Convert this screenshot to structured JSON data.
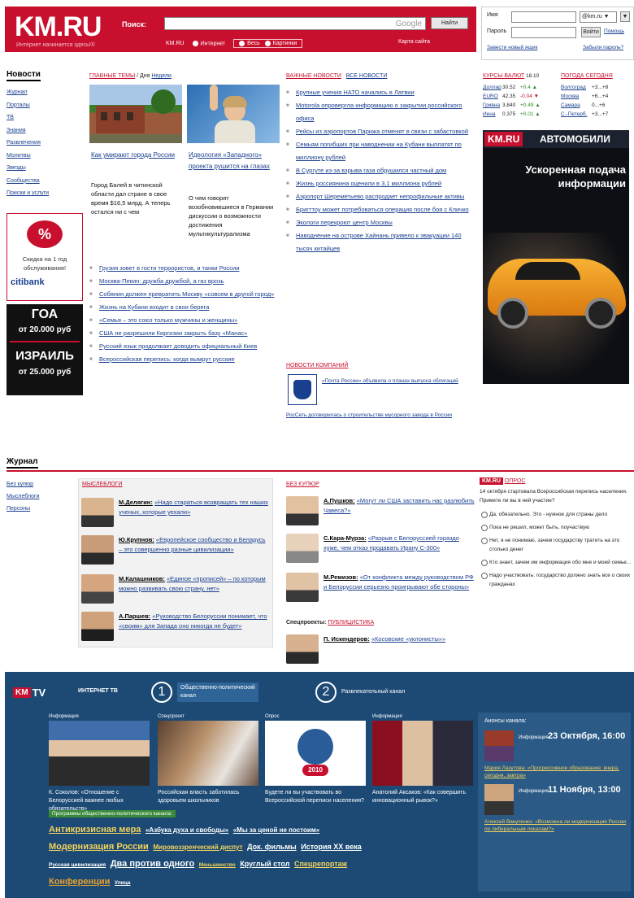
{
  "header": {
    "logo": "KM.RU",
    "tagline": "Интернет начинается здесь!®",
    "search_label": "Поиск:",
    "google": "Google",
    "find_button": "Найти",
    "scope_km": "KM.RU",
    "scope_internet": "Интернет",
    "scope_all": "Весь",
    "scope_images": "Картинки",
    "map": "Карта сайта"
  },
  "login": {
    "name_label": "Имя",
    "password_label": "Пароль",
    "domain": "@km.ru",
    "enter_button": "Войти",
    "help": "Помощь",
    "register": "Завести новый ящик",
    "forgot": "Забыли пароль?"
  },
  "left": {
    "news_title": "Новости",
    "news_items": [
      "Журнал",
      "Порталы",
      "ТВ",
      "Знания",
      "Развлечения",
      "Молитвы",
      "Звезды",
      "Сообщества",
      "Поиски и услуги"
    ],
    "citi_discount": "%",
    "citi_text": "Скидка на 1 год обслуживания!",
    "citi_brand": "citibank",
    "goa_title": "ГОА",
    "goa_price": "от 20.000 руб",
    "israel_title": "ИЗРАИЛЬ",
    "israel_price": "от 25.000 руб",
    "journal_title": "Журнал",
    "journal_items": [
      "Без купюр",
      "Мыслеблоги",
      "Персоны"
    ]
  },
  "main_topics": {
    "label": "Главные темы",
    "sep": "/ Дня",
    "week": "Недели",
    "story1_title": "Как умирают города России",
    "story1_desc": "Город Балей в читинской области дал стране в свое время $16,5 млрд. А теперь остался ни с чем",
    "story2_title": "Идеология «Западного» проекта рушится на глазах",
    "story2_desc": "О чем говорят возобновившиеся в Германии дискуссии о возможности достижения мультикультурализма",
    "list": [
      "Грузия зовет в гости террористов, и танки России",
      "Москва-Пекин: дружба дружбой, а газ врозь",
      "Собянин должен превратить Москву «совсем в другой город»",
      "Жизнь на Кубани входит в свои берега",
      "«Семья – это союз только мужчины и женщины»",
      "США не разрешили Киргизии закрыть базу «Манас»",
      "Русский язык продолжает доводить официальный Киев",
      "Всероссийская перепись: когда вымрут русские"
    ]
  },
  "important": {
    "label": "Важные новости",
    "all": "Все новости",
    "list": [
      "Крупные учения НАТО начались в Латвии",
      "Motorola опровергла информацию о закрытии российского офиса",
      "Рейсы из аэропортов Парижа отменят в связи с забастовкой",
      "Семьям погибших при наводнении на Кубани выплатят по миллиону рублей",
      "В Сургуте из-за взрыва газа обрушился частный дом",
      "Жизнь россиянина оценили в 3,1 миллиона рублей",
      "Аэропорт Шереметьево распродает непрофильные активы",
      "Бригттоу может потребоваться операция после боя с Кличко",
      "Экологи перекроют центр Москвы",
      "Наводнение на острове Хайнань привело к эвакуации 140 тысяч китайцев"
    ],
    "company_label": "Новости компаний",
    "company1": "«Почта России» объявила о планах выпуска облигаций",
    "company2": "РосСеть договорилась о строительстве мусорного завода в России"
  },
  "rates": {
    "label": "Курсы валют",
    "date": "18.10",
    "weather": "Погода сегодня",
    "rows": [
      {
        "name": "Доллар",
        "val": "30.52",
        "chg": "+0.4 ▲",
        "city": "Волгоград",
        "temp": "+3...+8"
      },
      {
        "name": "EURO",
        "val": "42.35",
        "chg": "-0.04 ▼",
        "city": "Москва",
        "temp": "+6...+4"
      },
      {
        "name": "Гривна",
        "val": "3.840",
        "chg": "+0.49 ▲",
        "city": "Самара",
        "temp": "0...+6"
      },
      {
        "name": "Иена",
        "val": "0.375",
        "chg": "+0.01 ▲",
        "city": "С.-Петерб.",
        "temp": "+3...+7"
      }
    ]
  },
  "car_ad": {
    "brand": "KM.RU",
    "title": "АВТОМОБИЛИ",
    "text": "Ускоренная подача информации"
  },
  "mysleblogi": {
    "label": "Мыслеблоги",
    "items": [
      {
        "name": "М.Делягин:",
        "text": "«Надо стараться возвращать тех наших ученых, которые уехали»"
      },
      {
        "name": "Ю.Крупнов:",
        "text": "«Европейское сообщество и Беларусь – это совершенно разные цивилизации»"
      },
      {
        "name": "М.Калашников:",
        "text": "«Единое «прописей» – по которым можно развивать свою страну, нет»"
      },
      {
        "name": "А.Паршев:",
        "text": "«Руководство Белоруссии понимает, что «своим» для Запада оно никогда не будет»"
      }
    ]
  },
  "bez_kupur": {
    "label": "Без купюр",
    "items": [
      {
        "name": "А.Пушков:",
        "text": "«Могут ли США заставить нас разлюбить Чавеса?»"
      },
      {
        "name": "С.Кара-Мурза:",
        "text": "«Разрыв с Белоруссией гораздо хуже, чем отказ продавать Ирану С-300»"
      },
      {
        "name": "М.Ремизов:",
        "text": "«От конфликта между руководством РФ и Белоруссии серьезно проигрывают обе стороны»"
      }
    ],
    "special_label": "Спецпроекты:",
    "special_link": "Публицистика",
    "special_name": "П. Искендеров:",
    "special_text": "«Косовские «уклонисты»»"
  },
  "poll": {
    "tag": "KM.RU",
    "label": "Опрос",
    "question": "14 октября стартовала Всероссийская перепись населения. Примете ли вы в ней участие?",
    "options": [
      "Да, обязательно. Это - нужное для страны дело",
      "Пока не решил, может быть, поучаствую",
      "Нет, я не понимаю, зачем государству тратить на это столько денег",
      "Кто знает, зачем им информация обо мне и моей семье...",
      "Надо участвовать: государство должно знать все о своих гражданах"
    ]
  },
  "tv": {
    "logo_km": "KM",
    "logo_tv": "TV",
    "internet_tv": "ИНТЕРНЕТ ТВ",
    "ch1_num": "1",
    "ch1_name": "Общественно-политический канал",
    "ch2_num": "2",
    "ch2_name": "Развлекательный канал",
    "thumbs": [
      {
        "tag": "Информация",
        "caption": "К. Соколов: «Отношение с Белоруссией важнее любых обязательств»"
      },
      {
        "tag": "Спецпроект",
        "caption": "Российская власть заботилась здоровьем школьников"
      },
      {
        "tag": "Опрос",
        "caption": "Будете ли вы участвовать во Всероссийской переписи населения?"
      },
      {
        "tag": "Информация",
        "caption": "Анатолий Аксаков: «Как совершить инновационный рывок?»"
      }
    ],
    "census_year": "2010",
    "programs_label": "Программы общественно-политического канала:",
    "row1": [
      "Антикризисная мера",
      "«Азбука духа и свободы»",
      "«Мы за ценой не постоим»"
    ],
    "row2": [
      "Модернизация России",
      "Мировоззренческий диспут",
      "Док. фильмы",
      "История XX века"
    ],
    "row3": [
      "Русская цивилизация",
      "Два против одного",
      "Меньшинство",
      "Круглый стол",
      "Спецрепортаж"
    ],
    "row4": [
      "Конференции",
      "Улица"
    ],
    "anons_label": "Анонсы канала:",
    "anons1_tag": "Информация",
    "anons1_date": "23 Октября, 16:00",
    "anons1_text": "Мария Лазутова: «Прогрессивное образование: вчера, сегодня, завтра»",
    "anons2_tag": "Информация",
    "anons2_date": "11 Ноября, 13:00",
    "anons2_text": "Алексей Вакуленко: «Возможна ли модернизация России по либеральным лекалам?»"
  }
}
